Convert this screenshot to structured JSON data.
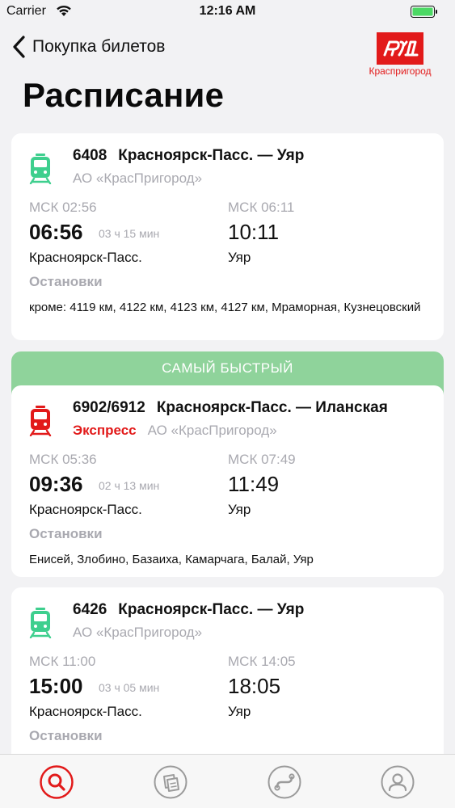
{
  "status_bar": {
    "carrier": "Carrier",
    "time": "12:16 AM"
  },
  "nav": {
    "back_label": "Покупка билетов"
  },
  "logo": {
    "caption": "Краспригород"
  },
  "page": {
    "title": "Расписание"
  },
  "fast_banner": {
    "label": "САМЫЙ БЫСТРЫЙ"
  },
  "trains": [
    {
      "number": "6408",
      "route": "Красноярск-Пасс. — Уяр",
      "express": "",
      "operator": "АО «КрасПригород»",
      "dep_msk": "МСК 02:56",
      "dep_time": "06:56",
      "duration": "03 ч 15 мин",
      "dep_station": "Красноярск-Пасс.",
      "arr_msk": "МСК 06:11",
      "arr_time": "10:11",
      "arr_station": "Уяр",
      "stops_label": "Остановки",
      "stops": "кроме: 4119 км, 4122 км, 4123 км, 4127 км, Мраморная, Кузнецовский",
      "icon_color": "#3ecf8e"
    },
    {
      "number": "6902/6912",
      "route": "Красноярск-Пасс. — Иланская",
      "express": "Экспресс",
      "operator": "АО «КрасПригород»",
      "dep_msk": "МСК 05:36",
      "dep_time": "09:36",
      "duration": "02 ч 13 мин",
      "dep_station": "Красноярск-Пасс.",
      "arr_msk": "МСК 07:49",
      "arr_time": "11:49",
      "arr_station": "Уяр",
      "stops_label": "Остановки",
      "stops": "Енисей, Злобино, Базаиха, Камарчага, Балай, Уяр",
      "icon_color": "#e21a1a"
    },
    {
      "number": "6426",
      "route": "Красноярск-Пасс. — Уяр",
      "express": "",
      "operator": "АО «КрасПригород»",
      "dep_msk": "МСК 11:00",
      "dep_time": "15:00",
      "duration": "03 ч 05 мин",
      "dep_station": "Красноярск-Пасс.",
      "arr_msk": "МСК 14:05",
      "arr_time": "18:05",
      "arr_station": "Уяр",
      "stops_label": "Остановки",
      "stops": "",
      "icon_color": "#3ecf8e"
    }
  ],
  "tabs": [
    {
      "icon": "search-icon",
      "active": true
    },
    {
      "icon": "tickets-icon",
      "active": false
    },
    {
      "icon": "routes-icon",
      "active": false
    },
    {
      "icon": "profile-icon",
      "active": false
    }
  ],
  "colors": {
    "accent": "#e21a1a",
    "fast_banner": "#8fd39b",
    "muted": "#a9a9b0",
    "inactive_tab": "#9b9b9b"
  }
}
